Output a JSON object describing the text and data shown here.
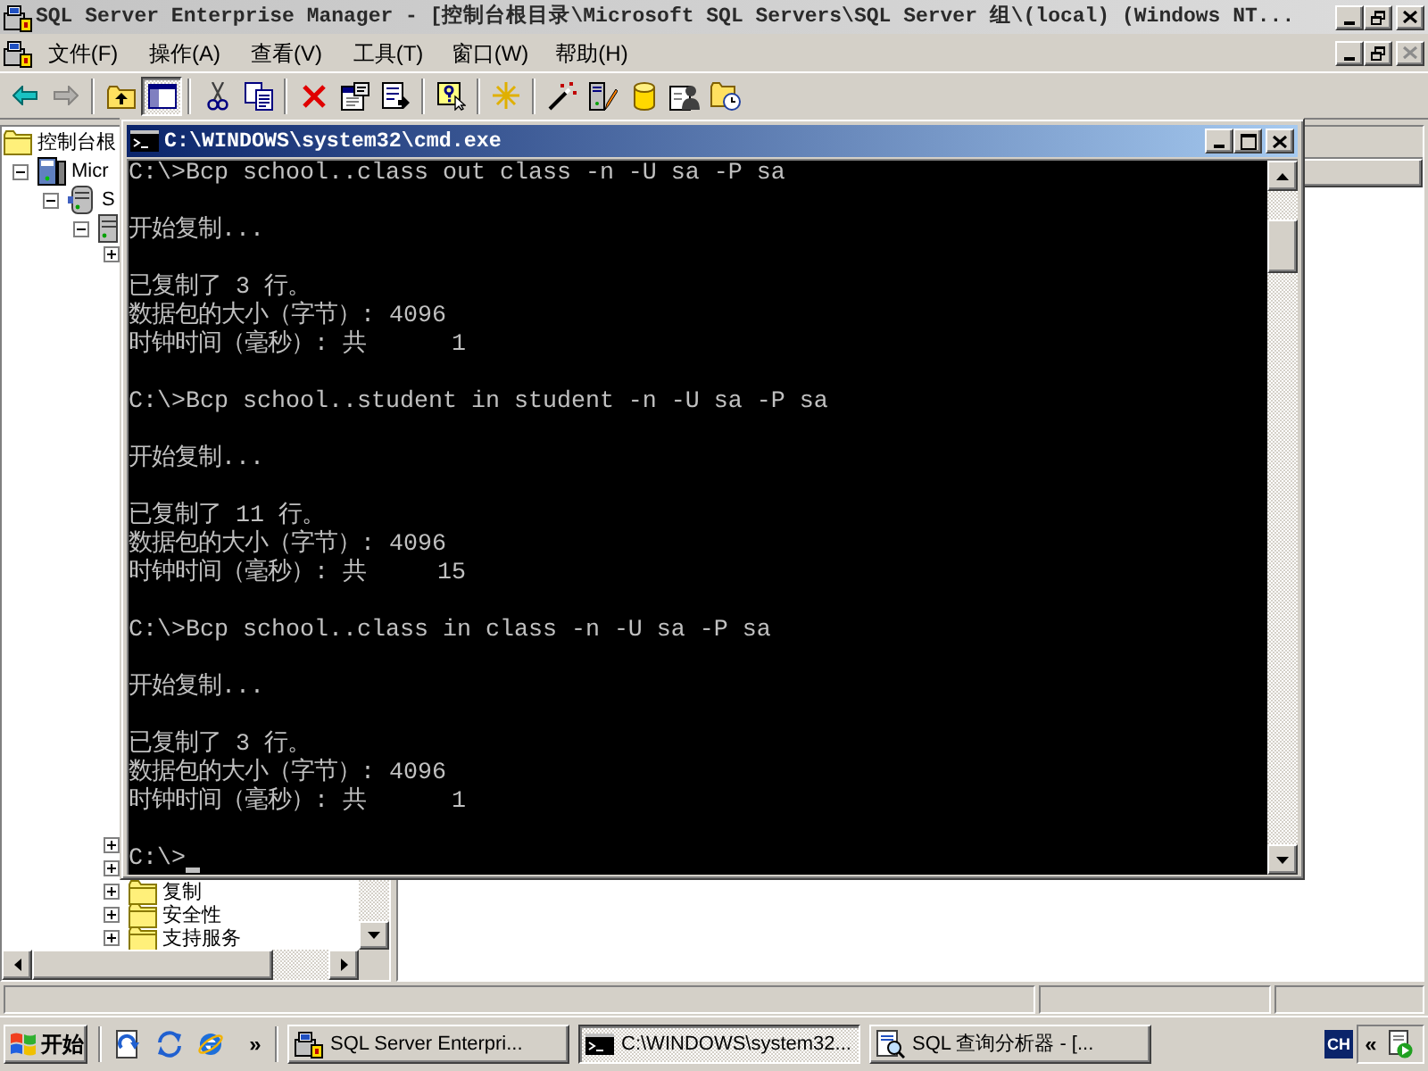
{
  "main_window": {
    "title": "SQL Server Enterprise Manager - [控制台根目录\\Microsoft SQL Servers\\SQL Server 组\\(local) (Windows NT...",
    "active": false,
    "controls": [
      {
        "kind": "minimize",
        "disabled": false
      },
      {
        "kind": "restore",
        "disabled": false
      },
      {
        "kind": "close",
        "disabled": false
      }
    ]
  },
  "menu_bar": {
    "items": [
      "文件(F)",
      "操作(A)",
      "查看(V)",
      "工具(T)",
      "窗口(W)",
      "帮助(H)"
    ],
    "document_controls": [
      {
        "kind": "minimize",
        "disabled": false
      },
      {
        "kind": "restore",
        "disabled": false
      },
      {
        "kind": "close",
        "disabled": true
      }
    ]
  },
  "toolbar": [
    {
      "kind": "button",
      "disabled": false,
      "pressed": false
    },
    {
      "kind": "button",
      "disabled": true,
      "pressed": false
    },
    {
      "kind": "separator"
    },
    {
      "kind": "button",
      "disabled": false,
      "pressed": false
    },
    {
      "kind": "button",
      "disabled": false,
      "pressed": true
    },
    {
      "kind": "separator"
    },
    {
      "kind": "button",
      "disabled": false,
      "pressed": false
    },
    {
      "kind": "button",
      "disabled": false,
      "pressed": false
    },
    {
      "kind": "separator"
    },
    {
      "kind": "button",
      "disabled": false,
      "pressed": false
    },
    {
      "kind": "button",
      "disabled": false,
      "pressed": false
    },
    {
      "kind": "button",
      "disabled": false,
      "pressed": false
    },
    {
      "kind": "separator"
    },
    {
      "kind": "button",
      "disabled": false,
      "pressed": false
    },
    {
      "kind": "separator"
    },
    {
      "kind": "button",
      "disabled": false,
      "pressed": false
    },
    {
      "kind": "separator"
    },
    {
      "kind": "button",
      "disabled": false,
      "pressed": false
    },
    {
      "kind": "button",
      "disabled": false,
      "pressed": false
    },
    {
      "kind": "button",
      "disabled": false,
      "pressed": false
    },
    {
      "kind": "button",
      "disabled": false,
      "pressed": false
    },
    {
      "kind": "button",
      "disabled": false,
      "pressed": false
    }
  ],
  "tree": [
    {
      "label": "控制台根",
      "children": [
        {
          "label": "Micr",
          "expanded": true,
          "children": [
            {
              "label": "S",
              "expanded": true,
              "children": [
                {
                  "expanded": true,
                  "children": [
                    {
                      "expanded": false
                    },
                    {
                      "expanded": false
                    },
                    {
                      "expanded": false
                    },
                    {
                      "label": "复制",
                      "expanded": false
                    },
                    {
                      "label": "安全性",
                      "expanded": false
                    },
                    {
                      "label": "支持服务",
                      "expanded": false
                    }
                  ]
                }
              ]
            }
          ]
        }
      ]
    }
  ],
  "console_window": {
    "title": "C:\\WINDOWS\\system32\\cmd.exe",
    "active": true,
    "controls": [
      {
        "kind": "minimize",
        "disabled": false
      },
      {
        "kind": "maximize",
        "disabled": false
      },
      {
        "kind": "close",
        "disabled": false
      }
    ],
    "sessions": [
      {
        "command": "C:\\>Bcp school..class out class -n -U sa -P sa",
        "output": [
          [
            "开始复制..."
          ],
          [
            "已复制了 3 行。",
            "数据包的大小（字节）: 4096",
            "时钟时间（毫秒）: 共      1"
          ]
        ]
      },
      {
        "command": "C:\\>Bcp school..student in student -n -U sa -P sa",
        "output": [
          [
            "开始复制..."
          ],
          [
            "已复制了 11 行。",
            "数据包的大小（字节）: 4096",
            "时钟时间（毫秒）: 共     15"
          ]
        ]
      },
      {
        "command": "C:\\>Bcp school..class in class -n -U sa -P sa",
        "output": [
          [
            "开始复制..."
          ],
          [
            "已复制了 3 行。",
            "数据包的大小（字节）: 4096",
            "时钟时间（毫秒）: 共      1"
          ]
        ]
      }
    ],
    "prompt": "C:\\>",
    "cursor": true
  },
  "taskbar": {
    "start_label": "开始",
    "quick_launch_more": "»",
    "tasks": [
      {
        "label": "SQL Server Enterpri...",
        "selected": false
      },
      {
        "label": "C:\\WINDOWS\\system32...",
        "selected": true
      },
      {
        "label": "SQL 查询分析器 - [...",
        "selected": false
      }
    ],
    "language": "CH",
    "tray_expand": "«"
  }
}
